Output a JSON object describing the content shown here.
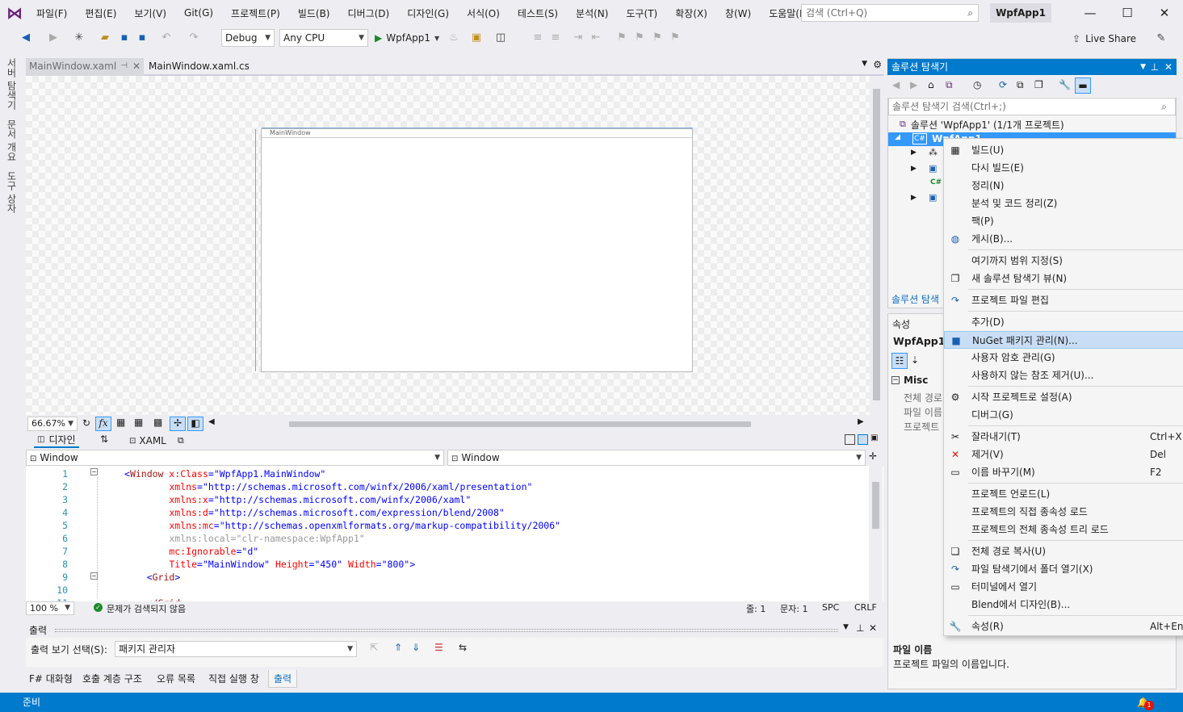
{
  "menu": [
    "파일(F)",
    "편집(E)",
    "보기(V)",
    "Git(G)",
    "프로젝트(P)",
    "빌드(B)",
    "디버그(D)",
    "디자인(G)",
    "서식(O)",
    "테스트(S)",
    "분석(N)",
    "도구(T)",
    "확장(X)",
    "창(W)",
    "도움말(H)"
  ],
  "search": {
    "placeholder": "검색 (Ctrl+Q)"
  },
  "solution_name": "WpfApp1",
  "window_controls": {
    "minimize": "—",
    "maximize": "☐",
    "close": "✕"
  },
  "toolbar": {
    "config": "Debug",
    "platform": "Any CPU",
    "start_label": "WpfApp1",
    "live_share": "Live Share"
  },
  "left_tabs": [
    "서버 탐색기",
    "문서 개요",
    "도구 상자"
  ],
  "doc_tabs": [
    {
      "label": "MainWindow.xaml",
      "active": false
    },
    {
      "label": "MainWindow.xaml.cs",
      "active": true
    }
  ],
  "designer": {
    "window_caption": "MainWindow"
  },
  "zoom": {
    "value": "66.67%",
    "fx": "fx"
  },
  "split": {
    "design_tab": "디자인",
    "swap": "⇅",
    "xaml_tab": "XAML"
  },
  "nav": {
    "left": "Window",
    "right": "Window"
  },
  "code_lines": [
    {
      "n": "1",
      "parts": [
        {
          "t": "<",
          "c": "v"
        },
        {
          "t": "Window",
          "c": "k"
        },
        {
          "t": " x:Class",
          "c": "a"
        },
        {
          "t": "=",
          "c": "v"
        },
        {
          "t": "\"WpfApp1.MainWindow\"",
          "c": "v"
        }
      ]
    },
    {
      "n": "2",
      "parts": [
        {
          "t": "        xmlns",
          "c": "a"
        },
        {
          "t": "=",
          "c": "v"
        },
        {
          "t": "\"http://schemas.microsoft.com/winfx/2006/xaml/presentation\"",
          "c": "v"
        }
      ]
    },
    {
      "n": "3",
      "parts": [
        {
          "t": "        xmlns:x",
          "c": "a"
        },
        {
          "t": "=",
          "c": "v"
        },
        {
          "t": "\"http://schemas.microsoft.com/winfx/2006/xaml\"",
          "c": "v"
        }
      ]
    },
    {
      "n": "4",
      "parts": [
        {
          "t": "        xmlns:d",
          "c": "a"
        },
        {
          "t": "=",
          "c": "v"
        },
        {
          "t": "\"http://schemas.microsoft.com/expression/blend/2008\"",
          "c": "v"
        }
      ]
    },
    {
      "n": "5",
      "parts": [
        {
          "t": "        xmlns:mc",
          "c": "a"
        },
        {
          "t": "=",
          "c": "v"
        },
        {
          "t": "\"http://schemas.openxmlformats.org/markup-compatibility/2006\"",
          "c": "v"
        }
      ]
    },
    {
      "n": "6",
      "parts": [
        {
          "t": "        xmlns:local=\"clr-namespace:WpfApp1\"",
          "c": "g"
        }
      ]
    },
    {
      "n": "7",
      "parts": [
        {
          "t": "        mc:Ignorable",
          "c": "a"
        },
        {
          "t": "=",
          "c": "v"
        },
        {
          "t": "\"d\"",
          "c": "v"
        }
      ]
    },
    {
      "n": "8",
      "parts": [
        {
          "t": "        Title",
          "c": "a"
        },
        {
          "t": "=",
          "c": "v"
        },
        {
          "t": "\"MainWindow\"",
          "c": "v"
        },
        {
          "t": " Height",
          "c": "a"
        },
        {
          "t": "=",
          "c": "v"
        },
        {
          "t": "\"450\"",
          "c": "v"
        },
        {
          "t": " Width",
          "c": "a"
        },
        {
          "t": "=",
          "c": "v"
        },
        {
          "t": "\"800\"",
          "c": "v"
        },
        {
          "t": ">",
          "c": "v"
        }
      ]
    },
    {
      "n": "9",
      "parts": [
        {
          "t": "    <",
          "c": "v"
        },
        {
          "t": "Grid",
          "c": "k"
        },
        {
          "t": ">",
          "c": "v"
        }
      ]
    },
    {
      "n": "10",
      "parts": []
    },
    {
      "n": "11",
      "parts": [
        {
          "t": "    </Grid>",
          "c": "k"
        }
      ]
    }
  ],
  "editor_status": {
    "zoom": "100 %",
    "issues": "문제가 검색되지 않음",
    "line": "줄: 1",
    "col": "문자: 1",
    "spc": "SPC",
    "crlf": "CRLF"
  },
  "output": {
    "title": "출력",
    "show_label": "출력 보기 선택(S):",
    "source": "패키지 관리자"
  },
  "bottom_tabs": [
    "F# 대화형",
    "호출 계층 구조",
    "오류 목록",
    "직접 실행 창",
    "출력"
  ],
  "solution_explorer": {
    "title": "솔루션 탐색기",
    "search_placeholder": "솔루션 탐색기 검색(Ctrl+;)",
    "root": "솔루션 'WpfApp1' (1/1개 프로젝트)",
    "project": "WpfApp1",
    "tab_label": "솔루션 탐색"
  },
  "properties": {
    "title": "속성",
    "object": "WpfApp1",
    "category": "Misc",
    "rows": [
      "전체 경로",
      "파일 이름",
      "프로젝트"
    ],
    "desc_title": "파일 이름",
    "desc_text": "프로젝트 파일의 이름입니다."
  },
  "context_menu": [
    {
      "type": "item",
      "label": "빌드(U)",
      "icon": "build-icon",
      "glyph": "▦"
    },
    {
      "type": "item",
      "label": "다시 빌드(E)"
    },
    {
      "type": "item",
      "label": "정리(N)"
    },
    {
      "type": "item",
      "label": "분석 및 코드 정리(Z)"
    },
    {
      "type": "item",
      "label": "팩(P)"
    },
    {
      "type": "item",
      "label": "게시(B)...",
      "icon": "globe-icon",
      "glyph": "◍"
    },
    {
      "type": "sep"
    },
    {
      "type": "item",
      "label": "여기까지 범위 지정(S)"
    },
    {
      "type": "item",
      "label": "새 솔루션 탐색기 뷰(N)",
      "icon": "new-view-icon",
      "glyph": "❐"
    },
    {
      "type": "sep"
    },
    {
      "type": "item",
      "label": "프로젝트 파일 편집",
      "icon": "edit-arrow-icon",
      "glyph": "↷"
    },
    {
      "type": "sep"
    },
    {
      "type": "item",
      "label": "추가(D)"
    },
    {
      "type": "item",
      "label": "NuGet 패키지 관리(N)...",
      "icon": "nuget-icon",
      "glyph": "■",
      "highlight": true
    },
    {
      "type": "item",
      "label": "사용자 암호 관리(G)"
    },
    {
      "type": "item",
      "label": "사용하지 않는 참조 제거(U)..."
    },
    {
      "type": "sep"
    },
    {
      "type": "item",
      "label": "시작 프로젝트로 설정(A)",
      "icon": "gear-icon",
      "glyph": "⚙"
    },
    {
      "type": "item",
      "label": "디버그(G)"
    },
    {
      "type": "sep"
    },
    {
      "type": "item",
      "label": "잘라내기(T)",
      "shortcut": "Ctrl+X",
      "icon": "scissors-icon",
      "glyph": "✂"
    },
    {
      "type": "item",
      "label": "제거(V)",
      "shortcut": "Del",
      "icon": "delete-icon",
      "glyph": "✕"
    },
    {
      "type": "item",
      "label": "이름 바꾸기(M)",
      "shortcut": "F2",
      "icon": "rename-icon",
      "glyph": "▭"
    },
    {
      "type": "sep"
    },
    {
      "type": "item",
      "label": "프로젝트 언로드(L)"
    },
    {
      "type": "item",
      "label": "프로젝트의 직접 종속성 로드"
    },
    {
      "type": "item",
      "label": "프로젝트의 전체 종속성 트리 로드"
    },
    {
      "type": "sep"
    },
    {
      "type": "item",
      "label": "전체 경로 복사(U)",
      "icon": "copy-icon",
      "glyph": "❏"
    },
    {
      "type": "item",
      "label": "파일 탐색기에서 폴더 열기(X)",
      "icon": "open-folder-icon",
      "glyph": "↷"
    },
    {
      "type": "item",
      "label": "터미널에서 열기",
      "icon": "terminal-icon",
      "glyph": "▭"
    },
    {
      "type": "item",
      "label": "Blend에서 디자인(B)..."
    },
    {
      "type": "sep"
    },
    {
      "type": "item",
      "label": "속성(R)",
      "shortcut": "Alt+Ent",
      "icon": "wrench-icon",
      "glyph": "🔧"
    }
  ],
  "status": {
    "text": "준비",
    "notifications": "1"
  },
  "colors": {
    "accent": "#007acc",
    "selection": "#3399ff",
    "highlight": "#c9def5"
  }
}
